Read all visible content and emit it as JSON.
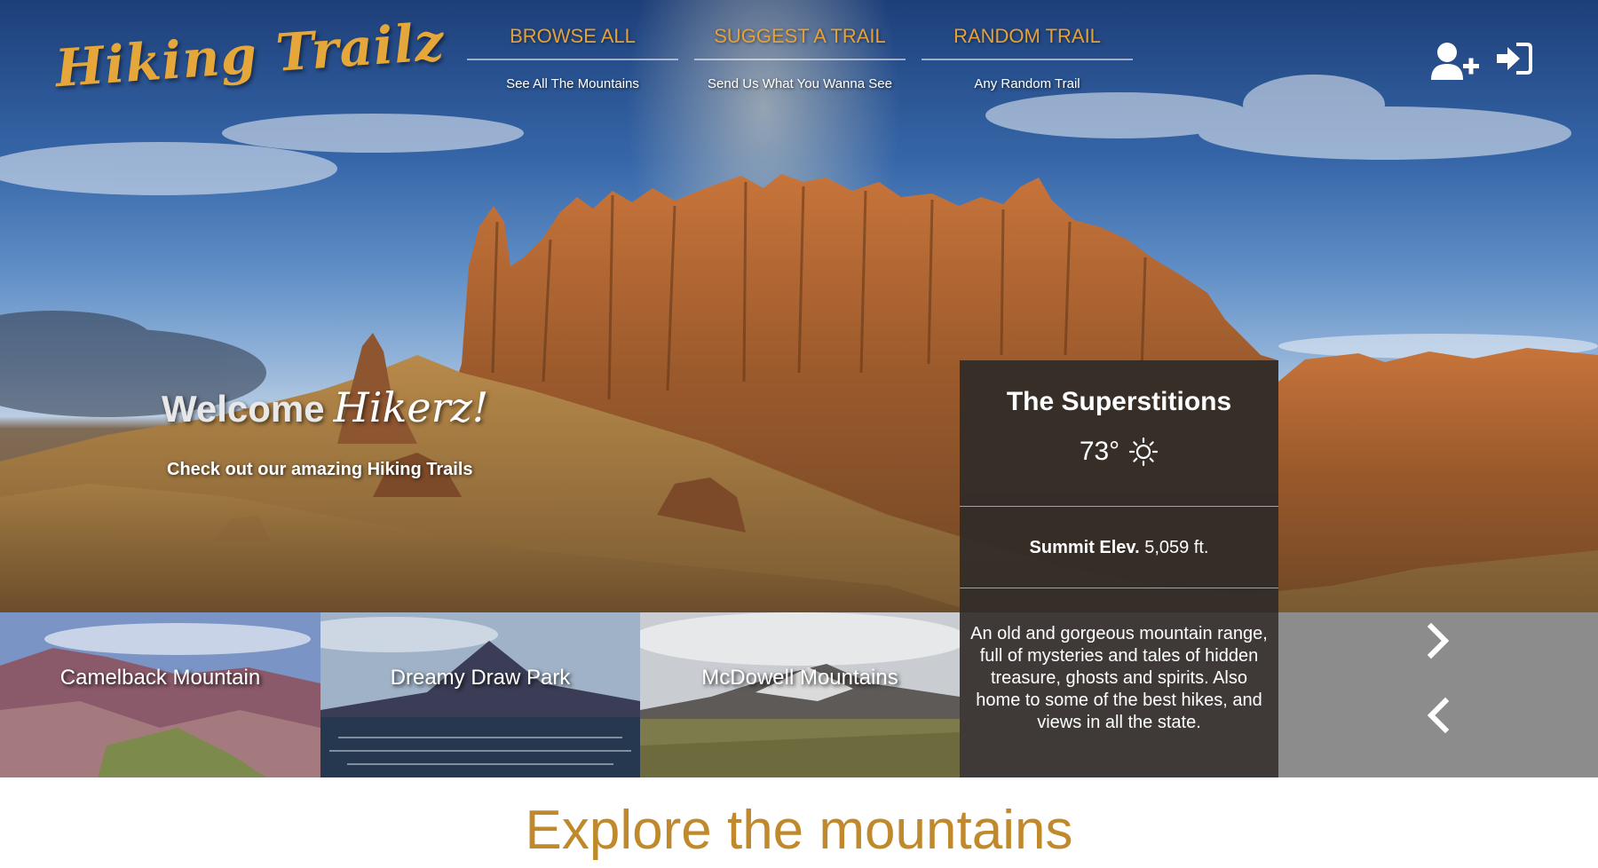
{
  "brand": {
    "logo_text": "Hiking Trailz"
  },
  "nav": [
    {
      "title": "BROWSE ALL",
      "sub": "See All The Mountains"
    },
    {
      "title": "SUGGEST A TRAIL",
      "sub": "Send Us What You Wanna See"
    },
    {
      "title": "RANDOM TRAIL",
      "sub": "Any Random Trail"
    }
  ],
  "icons": {
    "signup": "add-user-icon",
    "login": "sign-in-icon",
    "weather": "sun-icon",
    "next": "chevron-right-icon",
    "prev": "chevron-left-icon"
  },
  "hero": {
    "welcome_word": "Welcome",
    "welcome_script": "Hikerz!",
    "tagline": "Check out our amazing Hiking Trails"
  },
  "featured": {
    "name": "The Superstitions",
    "temperature": "73°",
    "elevation_label": "Summit Elev.",
    "elevation_value": "5,059 ft.",
    "description": "An old and gorgeous mountain range, full of mysteries and tales of hidden treasure, ghosts and spirits. Also home to some of the best hikes, and views in all the state."
  },
  "trails": [
    {
      "name": "Camelback Mountain"
    },
    {
      "name": "Dreamy Draw Park"
    },
    {
      "name": "McDowell Mountains"
    }
  ],
  "section": {
    "explore_title": "Explore the mountains"
  },
  "colors": {
    "accent": "#e4a13a",
    "explore_text": "#c08a2c",
    "card_bg": "#302b28",
    "arrow_panel": "#8c8c8c"
  }
}
